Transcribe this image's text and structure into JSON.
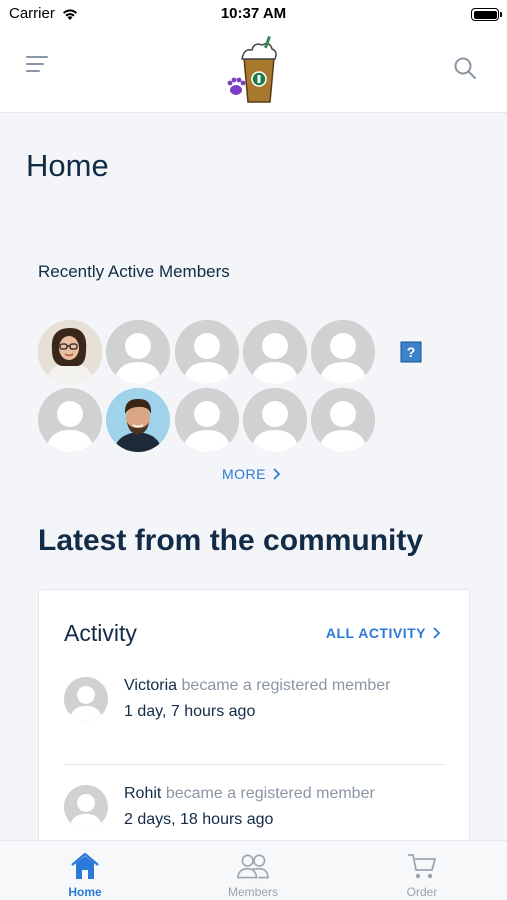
{
  "status_bar": {
    "carrier": "Carrier",
    "time": "10:37 AM"
  },
  "header": {
    "logo": "frappe-cup-logo",
    "menu_icon": "menu-icon",
    "search_icon": "search-icon"
  },
  "page": {
    "title": "Home"
  },
  "members": {
    "heading": "Recently Active Members",
    "more_label": "MORE"
  },
  "community": {
    "heading": "Latest from the community"
  },
  "activity": {
    "title": "Activity",
    "all_label": "ALL ACTIVITY",
    "items": [
      {
        "name": "Victoria",
        "action": "became a registered member",
        "time": "1 day, 7 hours ago"
      },
      {
        "name": "Rohit",
        "action": "became a registered member",
        "time": "2 days, 18 hours ago"
      }
    ]
  },
  "tabs": [
    {
      "label": "Home",
      "icon": "home-icon",
      "active": true
    },
    {
      "label": "Members",
      "icon": "members-icon",
      "active": false
    },
    {
      "label": "Order",
      "icon": "cart-icon",
      "active": false
    }
  ],
  "colors": {
    "accent": "#2b7ad8",
    "text_dark": "#122b46",
    "text_muted": "#8a96a3",
    "placeholder_avatar": "#d1d1d1"
  }
}
